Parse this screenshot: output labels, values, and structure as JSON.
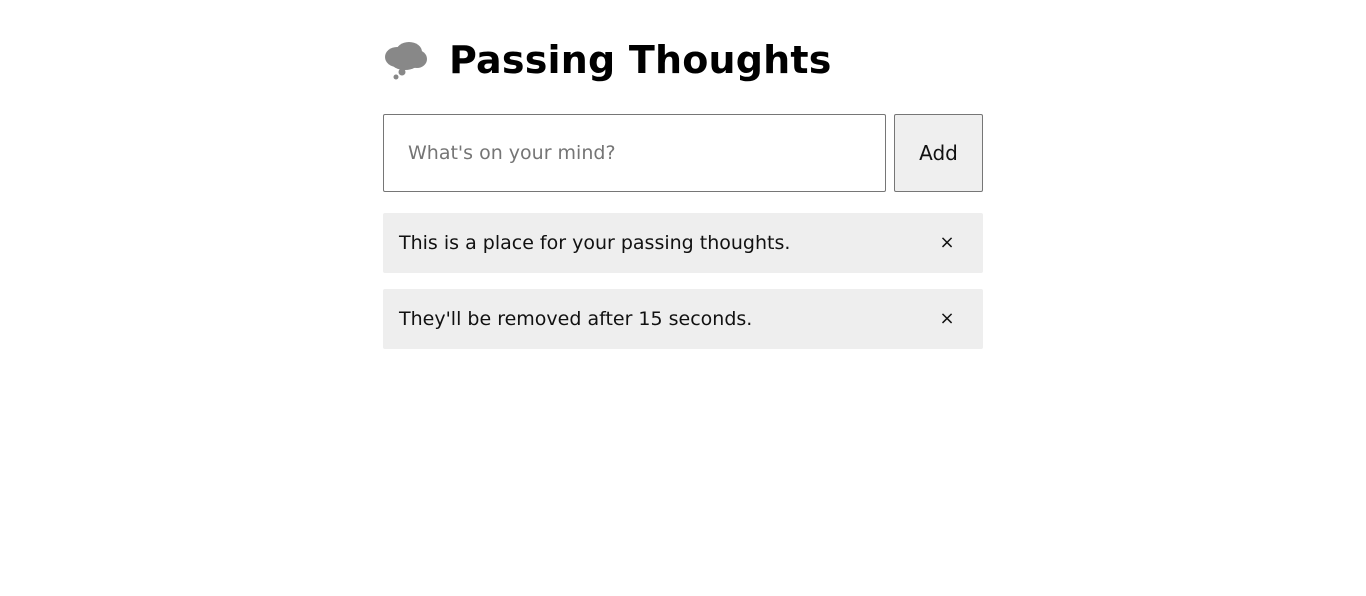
{
  "header": {
    "icon": "thought-balloon-icon",
    "title": "Passing Thoughts"
  },
  "form": {
    "placeholder": "What's on your mind?",
    "value": "",
    "add_label": "Add"
  },
  "thoughts": [
    {
      "text": "This is a place for your passing thoughts.",
      "remove_label": "×"
    },
    {
      "text": "They'll be removed after 15 seconds.",
      "remove_label": "×"
    }
  ],
  "colors": {
    "icon": "#888888",
    "thought_background": "#eeeeee",
    "button_background": "#efefef",
    "border": "#767676"
  }
}
